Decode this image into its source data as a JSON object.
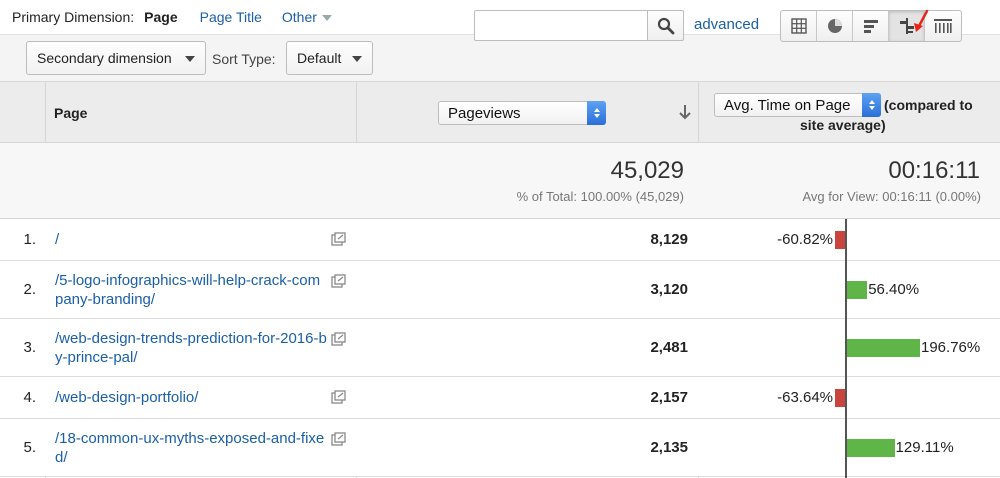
{
  "dimension_bar": {
    "label": "Primary Dimension:",
    "active": "Page",
    "page_title": "Page Title",
    "other": "Other"
  },
  "toolbar": {
    "secondary_dimension": "Secondary dimension",
    "sort_type_label": "Sort Type:",
    "sort_type_value": "Default",
    "search_value": "",
    "advanced": "advanced",
    "view_buttons": [
      "data-table-icon",
      "pie-chart-icon",
      "performance-icon",
      "comparison-icon",
      "term-cloud-icon"
    ],
    "selected_view": "comparison-icon"
  },
  "table": {
    "header": {
      "page": "Page",
      "metric": "Pageviews",
      "compare_metric": "Avg. Time on Page",
      "compare_note": "(compared to site average)"
    },
    "totals": {
      "pageviews": "45,029",
      "pageviews_sub": "% of Total: 100.00% (45,029)",
      "avg_time": "00:16:11",
      "avg_time_sub": "Avg for View: 00:16:11 (0.00%)"
    },
    "rows": [
      {
        "num": "1.",
        "page": "/",
        "pageviews": "8,129",
        "compare_pct": -60.82,
        "compare_label": "-60.82%"
      },
      {
        "num": "2.",
        "page": "/5-logo-infographics-will-help-crack-company-branding/",
        "pageviews": "3,120",
        "compare_pct": 56.4,
        "compare_label": "56.40%"
      },
      {
        "num": "3.",
        "page": "/web-design-trends-prediction-for-2016-by-prince-pal/",
        "pageviews": "2,481",
        "compare_pct": 196.76,
        "compare_label": "196.76%"
      },
      {
        "num": "4.",
        "page": "/web-design-portfolio/",
        "pageviews": "2,157",
        "compare_pct": -63.64,
        "compare_label": "-63.64%"
      },
      {
        "num": "5.",
        "page": "/18-common-ux-myths-exposed-and-fixed/",
        "pageviews": "2,135",
        "compare_pct": 129.11,
        "compare_label": "129.11%"
      }
    ]
  },
  "colors": {
    "link": "#1a5fa8",
    "negative_bar": "#c9443c",
    "positive_bar": "#5fb547",
    "annotation_arrow": "#e8231a"
  }
}
